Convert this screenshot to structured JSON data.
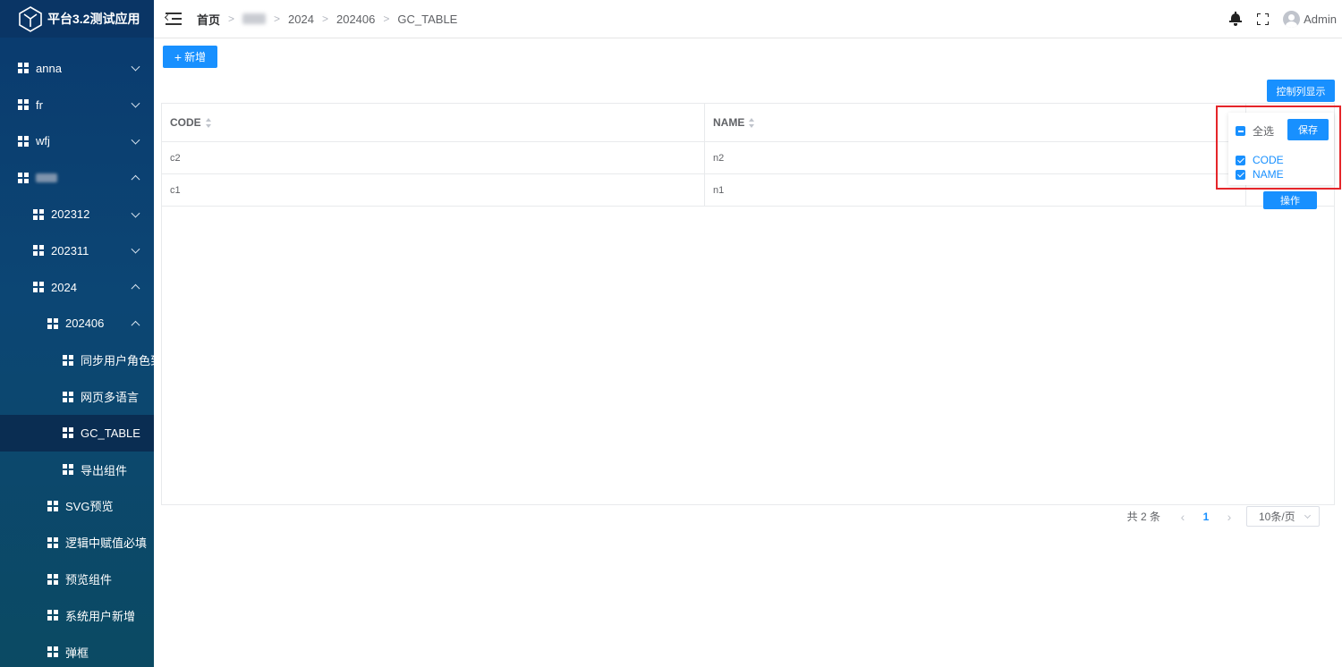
{
  "app": {
    "title": "平台3.2测试应用",
    "accent_color": "#1890ff",
    "sidebar_color": "#0c4674",
    "highlight_color": "#e5252a"
  },
  "sidebar": {
    "items": [
      {
        "label": "anna",
        "level": 1,
        "expandable": true,
        "expanded": false
      },
      {
        "label": "fr",
        "level": 1,
        "expandable": true,
        "expanded": false
      },
      {
        "label": "wfj",
        "level": 1,
        "expandable": true,
        "expanded": false
      },
      {
        "label": "",
        "level": 1,
        "expandable": true,
        "expanded": true,
        "obscured": true
      },
      {
        "label": "202312",
        "level": 2,
        "expandable": true,
        "expanded": false
      },
      {
        "label": "202311",
        "level": 2,
        "expandable": true,
        "expanded": false
      },
      {
        "label": "2024",
        "level": 2,
        "expandable": true,
        "expanded": true
      },
      {
        "label": "202406",
        "level": 3,
        "expandable": true,
        "expanded": true
      },
      {
        "label": "同步用户角色到",
        "level": 4,
        "expandable": false
      },
      {
        "label": "网页多语言",
        "level": 4,
        "expandable": false
      },
      {
        "label": "GC_TABLE",
        "level": 4,
        "expandable": false,
        "active": true
      },
      {
        "label": "导出组件",
        "level": 4,
        "expandable": false
      },
      {
        "label": "SVG预览",
        "level": 3,
        "expandable": false
      },
      {
        "label": "逻辑中赋值必填",
        "level": 3,
        "expandable": false
      },
      {
        "label": "预览组件",
        "level": 3,
        "expandable": false
      },
      {
        "label": "系统用户新增",
        "level": 3,
        "expandable": false
      },
      {
        "label": "弹框",
        "level": 3,
        "expandable": false
      }
    ]
  },
  "header": {
    "breadcrumb": [
      "首页",
      "",
      "2024",
      "202406",
      "GC_TABLE"
    ],
    "user_name": "Admin"
  },
  "toolbar": {
    "add_label": "新增",
    "column_toggle_label": "控制列显示"
  },
  "table": {
    "columns": [
      "CODE",
      "NAME"
    ],
    "rows": [
      {
        "code": "c2",
        "name": "n2"
      },
      {
        "code": "c1",
        "name": "n1"
      }
    ],
    "operation_label": "操作"
  },
  "pagination": {
    "total_text": "共 2 条",
    "current_page": "1",
    "page_size": "10条/页"
  },
  "column_popover": {
    "select_all_label": "全选",
    "save_label": "保存",
    "columns": [
      "CODE",
      "NAME"
    ]
  }
}
